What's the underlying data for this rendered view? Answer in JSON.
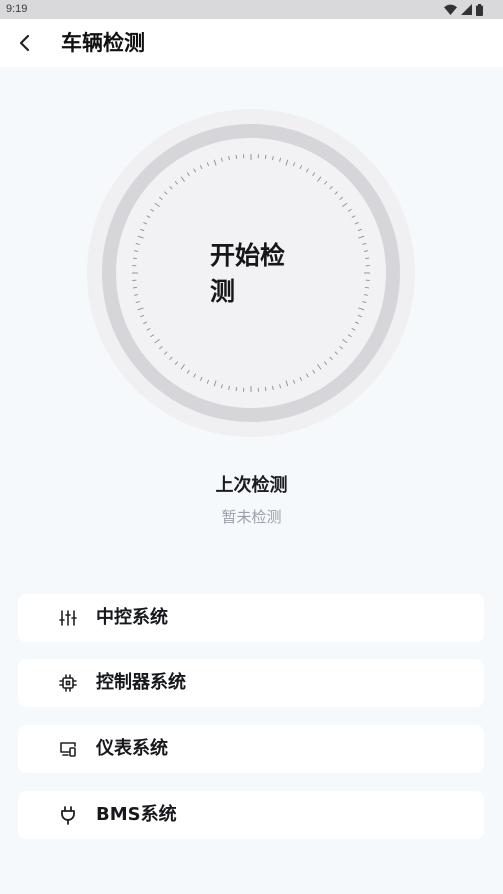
{
  "status_bar": {
    "time": "9:19",
    "icons": [
      "wifi-icon",
      "signal-icon",
      "battery-icon"
    ]
  },
  "header": {
    "title": "车辆检测",
    "back_icon": "back-arrow-icon"
  },
  "dial": {
    "label": "开始检测"
  },
  "last_detection": {
    "title": "上次检测",
    "value": "暂未检测"
  },
  "systems": [
    {
      "label": "中控系统",
      "icon": "sliders-icon"
    },
    {
      "label": "控制器系统",
      "icon": "chip-icon"
    },
    {
      "label": "仪表系统",
      "icon": "display-icon"
    },
    {
      "label": "BMS系统",
      "icon": "plug-icon"
    }
  ],
  "colors": {
    "background": "#f6f9fc",
    "card": "#ffffff",
    "dial_outer": "#f0f0f2",
    "dial_ring": "#d6d6da",
    "dial_inner": "#f2f2f4",
    "muted_text": "#9aa0a8"
  }
}
